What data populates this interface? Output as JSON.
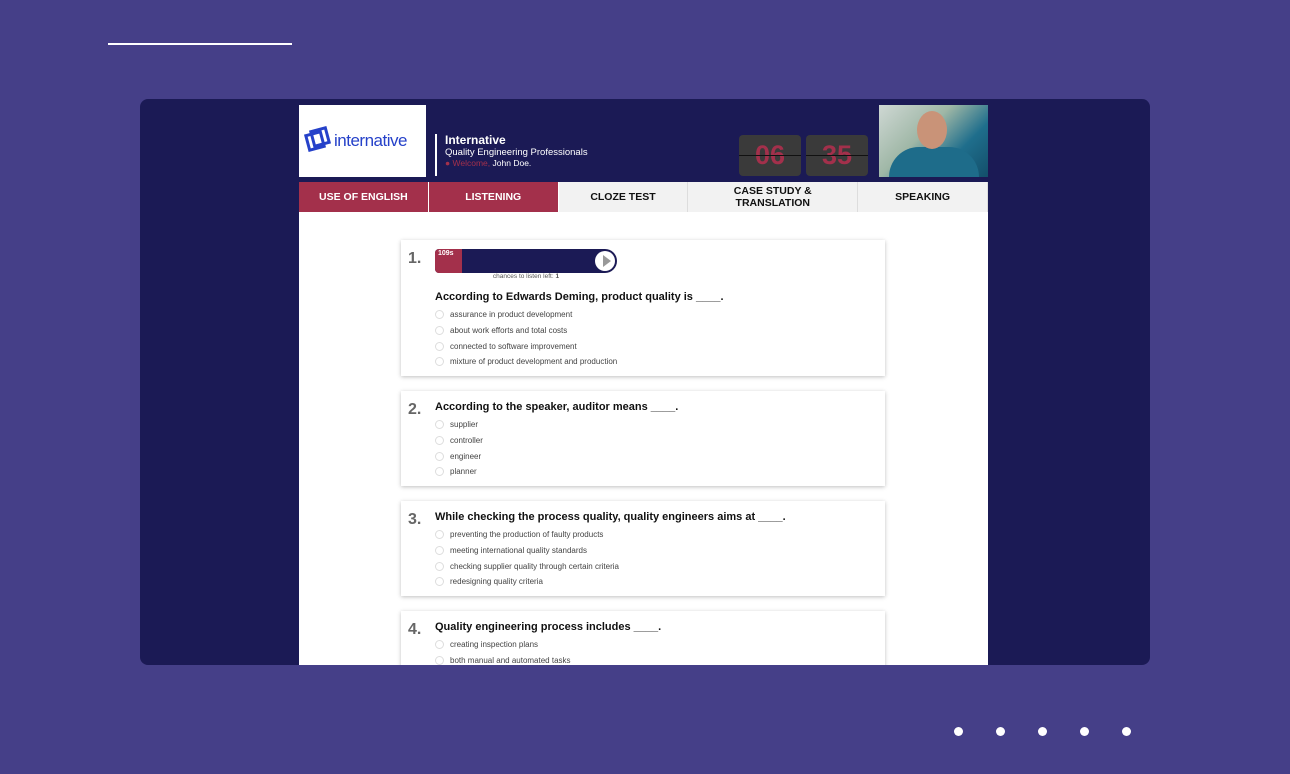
{
  "header": {
    "logo_text": "internative",
    "brand_title": "Internative",
    "brand_subtitle": "Quality Engineering Professionals",
    "welcome_label": "Welcome,",
    "user_name": "John Doe.",
    "timer_minutes": "06",
    "timer_seconds": "35"
  },
  "tabs": [
    {
      "label": "USE OF ENGLISH",
      "state": "done"
    },
    {
      "label": "LISTENING",
      "state": "active"
    },
    {
      "label": "CLOZE TEST"
    },
    {
      "label": "CASE STUDY & TRANSLATION"
    },
    {
      "label": "SPEAKING"
    }
  ],
  "player": {
    "time": "109s",
    "progress_percent": 15,
    "chances_label": "chances to listen left:",
    "chances": "1"
  },
  "questions": [
    {
      "number": "1.",
      "text": "According to Edwards Deming, product quality is ____.",
      "options": [
        "assurance in product development",
        "about work efforts and total costs",
        "connected to software improvement",
        "mixture of product development and production"
      ]
    },
    {
      "number": "2.",
      "text": "According to the speaker, auditor means ____.",
      "options": [
        "supplier",
        "controller",
        "engineer",
        "planner"
      ]
    },
    {
      "number": "3.",
      "text": "While checking the process quality, quality engineers aims at ____.",
      "options": [
        "preventing the production of faulty products",
        "meeting international quality standards",
        "checking supplier quality through certain criteria",
        "redesigning quality criteria"
      ]
    },
    {
      "number": "4.",
      "text": "Quality engineering process includes ____.",
      "options": [
        "creating inspection plans",
        "both manual and automated tasks"
      ]
    }
  ],
  "colors": {
    "accent": "#a3304b",
    "navy": "#1b1a55",
    "background": "#453f88"
  }
}
